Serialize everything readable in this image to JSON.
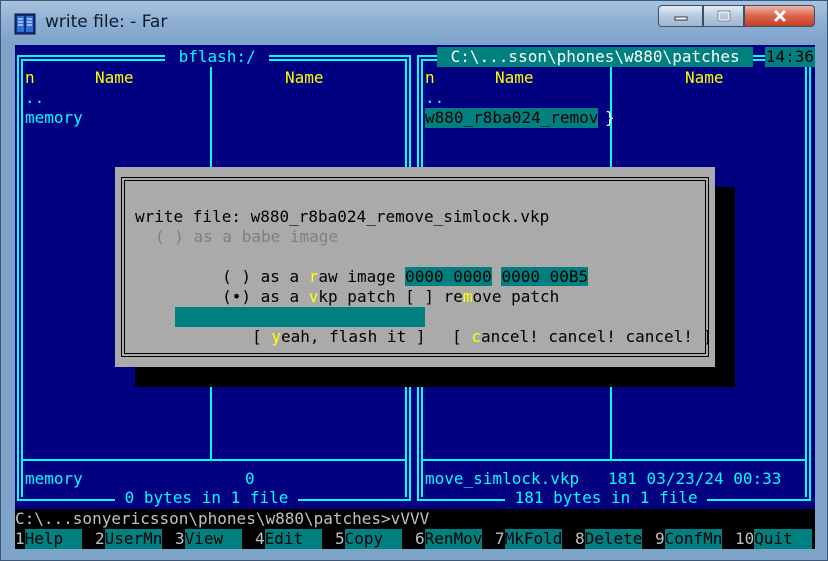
{
  "window": {
    "title": "write file: - Far",
    "app_icon": "far-manager-icon",
    "controls": [
      "minimize-icon",
      "maximize-icon",
      "close-icon"
    ]
  },
  "left_panel": {
    "title": " bflash:/ ",
    "col_n": "n",
    "col_name1": "Name",
    "col_name2": "Name",
    "items": [
      "..",
      "memory"
    ],
    "status_name": "memory",
    "status_size": "0",
    "summary": " 0 bytes in 1 file "
  },
  "right_panel": {
    "title": " C:\\...sson\\phones\\w880\\patches ",
    "clock": "14:36",
    "col_n": "n",
    "col_name1": "Name",
    "col_name2": "Name",
    "items": [
      "..",
      "w880_r8ba024_remov"
    ],
    "selected_overflow": "}",
    "status_line": "move_simlock.vkp   181 03/23/24 00:33",
    "summary": " 181 bytes in 1 file "
  },
  "dialog": {
    "prompt": "write file: w880_r8ba024_remove_simlock.vkp",
    "option_babe": "( ) as a babe image",
    "option_raw_pre": "( ) as a ",
    "option_raw_hot": "r",
    "option_raw_post": "aw image ",
    "hex1": "0000 0000",
    "hex2": "0000 00B5",
    "option_vkp_pre": "(•) as a ",
    "option_vkp_hot": "v",
    "option_vkp_mid": "kp patch [ ] re",
    "option_vkp_hot2": "m",
    "option_vkp_post": "ove patch",
    "flash_pre": "[ ",
    "flash_hot": "y",
    "flash_post": "eah, flash it ]",
    "cancel_pre": "[ ",
    "cancel_hot": "c",
    "cancel_post": "ancel! cancel! cancel! ]"
  },
  "command_line": "C:\\...sonyericsson\\phones\\w880\\patches>vVVV",
  "keybar": [
    {
      "num": "1",
      "label": "Help  "
    },
    {
      "num": "2",
      "label": "UserMn"
    },
    {
      "num": "3",
      "label": "View  "
    },
    {
      "num": "4",
      "label": "Edit  "
    },
    {
      "num": "5",
      "label": "Copy  "
    },
    {
      "num": "6",
      "label": "RenMov"
    },
    {
      "num": "7",
      "label": "MkFold"
    },
    {
      "num": "8",
      "label": "Delete"
    },
    {
      "num": "9",
      "label": "ConfMn"
    },
    {
      "num": "10",
      "label": "Quit  "
    }
  ],
  "colors": {
    "console_bg": "#000080",
    "frame": "#00ffff",
    "header": "#ffff00",
    "selection": "#008080",
    "dialog_bg": "#aaaaaa"
  }
}
